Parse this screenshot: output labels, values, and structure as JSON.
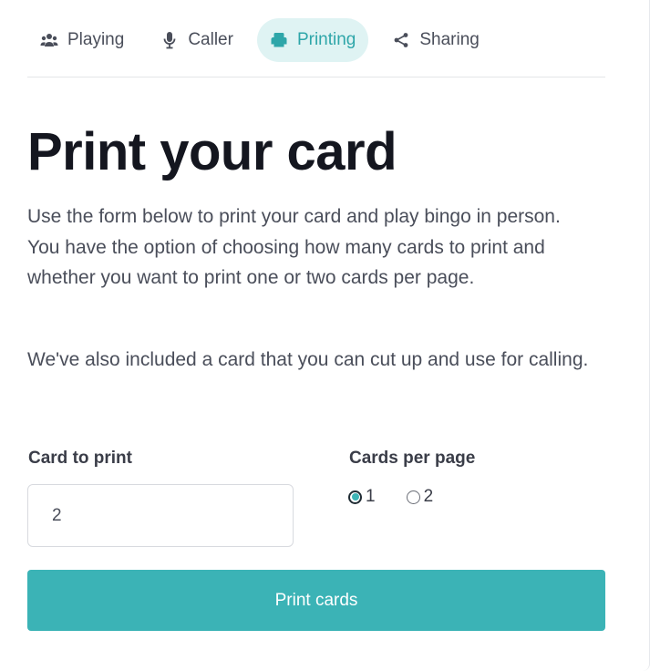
{
  "tabs": [
    {
      "label": "Playing",
      "icon": "people-icon"
    },
    {
      "label": "Caller",
      "icon": "microphone-icon"
    },
    {
      "label": "Printing",
      "icon": "printer-icon",
      "active": true
    },
    {
      "label": "Sharing",
      "icon": "share-icon"
    }
  ],
  "page": {
    "title": "Print your card",
    "intro": "Use the form below to print your card and play bingo in person. You have the option of choosing how many cards to print and whether you want to print one or two cards per page.",
    "note": "We've also included a card that you can cut up and use for calling."
  },
  "form": {
    "card_label": "Card to print",
    "card_value": "2",
    "per_page_label": "Cards per page",
    "per_page_options": [
      "1",
      "2"
    ],
    "per_page_selected": "1",
    "submit_label": "Print cards"
  },
  "colors": {
    "accent": "#3bb3b6",
    "active_tab_bg": "#dff3f3",
    "active_tab_text": "#2ea6a9",
    "heading": "#14161f",
    "body_text": "#4a4e5a"
  }
}
